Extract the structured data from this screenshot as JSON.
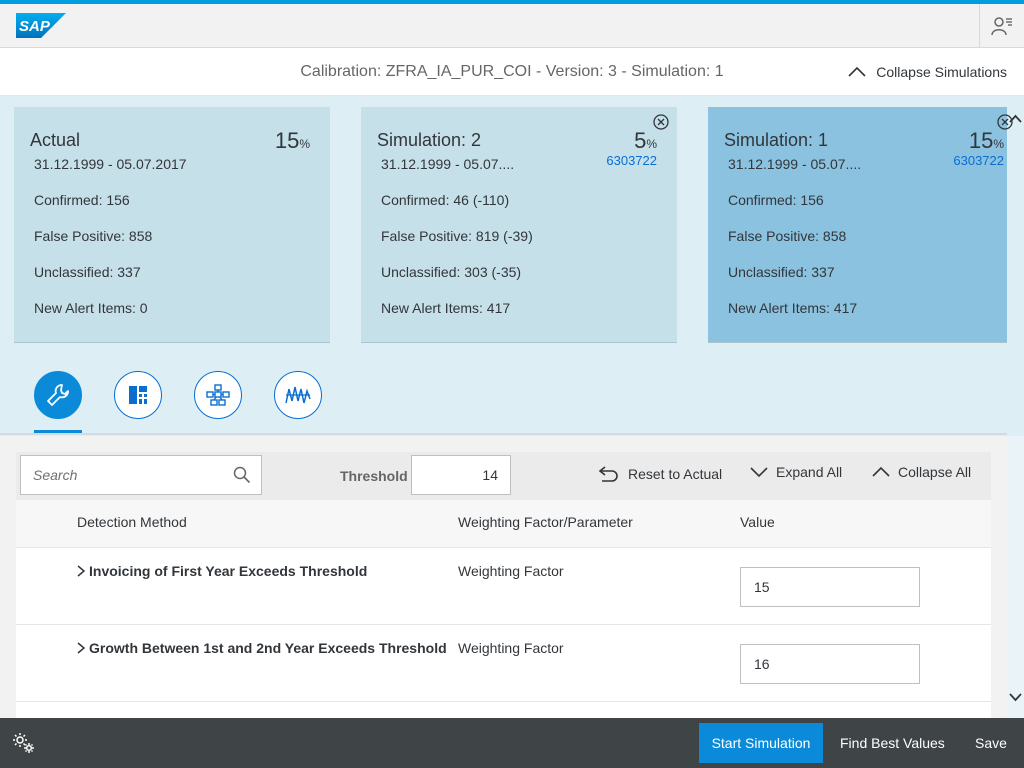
{
  "shell": {
    "logo_text": "SAP"
  },
  "header": {
    "title": "Calibration: ZFRA_IA_PUR_COI - Version: 3 - Simulation: 1",
    "collapse_simulations": "Collapse Simulations"
  },
  "cards": [
    {
      "title": "Actual",
      "percent": "15",
      "percent_unit": "%",
      "id": "",
      "date_range": "31.12.1999 - 05.07.2017",
      "confirmed": "Confirmed: 156",
      "false_positive": "False Positive: 858",
      "unclassified": "Unclassified: 337",
      "new_alert_items": "New Alert Items: 0"
    },
    {
      "title": "Simulation: 2",
      "percent": "5",
      "percent_unit": "%",
      "id": "6303722",
      "date_range": "31.12.1999 - 05.07....",
      "confirmed": "Confirmed: 46 (-110)",
      "false_positive": "False Positive: 819 (-39)",
      "unclassified": "Unclassified: 303 (-35)",
      "new_alert_items": "New Alert Items: 417"
    },
    {
      "title": "Simulation: 1",
      "percent": "15",
      "percent_unit": "%",
      "id": "6303722",
      "date_range": "31.12.1999 - 05.07....",
      "confirmed": "Confirmed: 156",
      "false_positive": "False Positive: 858",
      "unclassified": "Unclassified: 337",
      "new_alert_items": "New Alert Items: 417"
    }
  ],
  "tabs": [
    {
      "icon": "wrench-icon",
      "selected": true
    },
    {
      "icon": "layout-icon",
      "selected": false
    },
    {
      "icon": "network-icon",
      "selected": false
    },
    {
      "icon": "waveform-icon",
      "selected": false
    }
  ],
  "toolbar": {
    "search_placeholder": "Search",
    "threshold_label": "Threshold",
    "threshold_value": "14",
    "reset_label": "Reset to Actual",
    "expand_label": "Expand All",
    "collapse_label": "Collapse All"
  },
  "table": {
    "columns": [
      "Detection Method",
      "Weighting Factor/Parameter",
      "Value"
    ],
    "rows": [
      {
        "method": "Invoicing of First Year Exceeds Threshold",
        "param": "Weighting Factor",
        "value": "15"
      },
      {
        "method": "Growth Between 1st and 2nd Year Exceeds Threshold",
        "param": "Weighting Factor",
        "value": "16"
      }
    ]
  },
  "footer": {
    "start_simulation": "Start Simulation",
    "find_best_values": "Find Best Values",
    "save": "Save"
  },
  "colors": {
    "accent": "#0a8ad8",
    "link": "#0a6ed1",
    "card": "#c6e0ea",
    "card_active": "#8ac2e0",
    "footer": "#3f4447"
  }
}
